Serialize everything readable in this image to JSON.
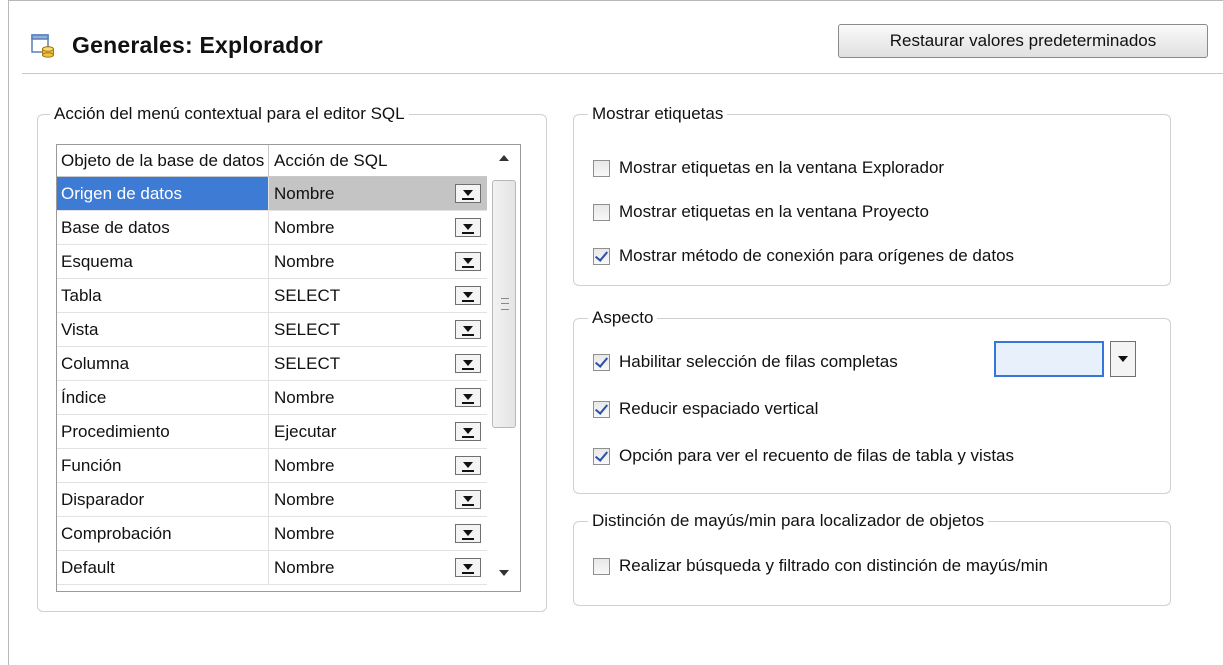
{
  "header": {
    "title": "Generales: Explorador",
    "restore_button": "Restaurar valores predeterminados"
  },
  "sql_group": {
    "legend": "Acción del menú contextual para el editor SQL",
    "columns": [
      "Objeto de la base de datos",
      "Acción de SQL"
    ],
    "rows": [
      {
        "object": "Origen de datos",
        "action": "Nombre"
      },
      {
        "object": "Base de datos",
        "action": "Nombre"
      },
      {
        "object": "Esquema",
        "action": "Nombre"
      },
      {
        "object": "Tabla",
        "action": "SELECT"
      },
      {
        "object": "Vista",
        "action": "SELECT"
      },
      {
        "object": "Columna",
        "action": "SELECT"
      },
      {
        "object": "Índice",
        "action": "Nombre"
      },
      {
        "object": "Procedimiento",
        "action": "Ejecutar"
      },
      {
        "object": "Función",
        "action": "Nombre"
      },
      {
        "object": "Disparador",
        "action": "Nombre"
      },
      {
        "object": "Comprobación",
        "action": "Nombre"
      },
      {
        "object": "Default",
        "action": "Nombre"
      }
    ]
  },
  "tags_group": {
    "legend": "Mostrar etiquetas",
    "options": [
      {
        "label": "Mostrar etiquetas en la ventana Explorador",
        "checked": false
      },
      {
        "label": "Mostrar etiquetas en la ventana Proyecto",
        "checked": false
      },
      {
        "label": "Mostrar método de conexión para orígenes de datos",
        "checked": true
      }
    ]
  },
  "aspect_group": {
    "legend": "Aspecto",
    "options": [
      {
        "label": "Habilitar selección de filas completas",
        "checked": true
      },
      {
        "label": "Reducir espaciado vertical",
        "checked": true
      },
      {
        "label": "Opción para ver el recuento de filas de tabla y vistas",
        "checked": true
      }
    ],
    "selection_color": "#e8f0fb"
  },
  "case_group": {
    "legend": "Distinción de mayús/min para localizador de objetos",
    "options": [
      {
        "label": "Realizar búsqueda y filtrado con distinción de mayús/min",
        "checked": false
      }
    ]
  }
}
